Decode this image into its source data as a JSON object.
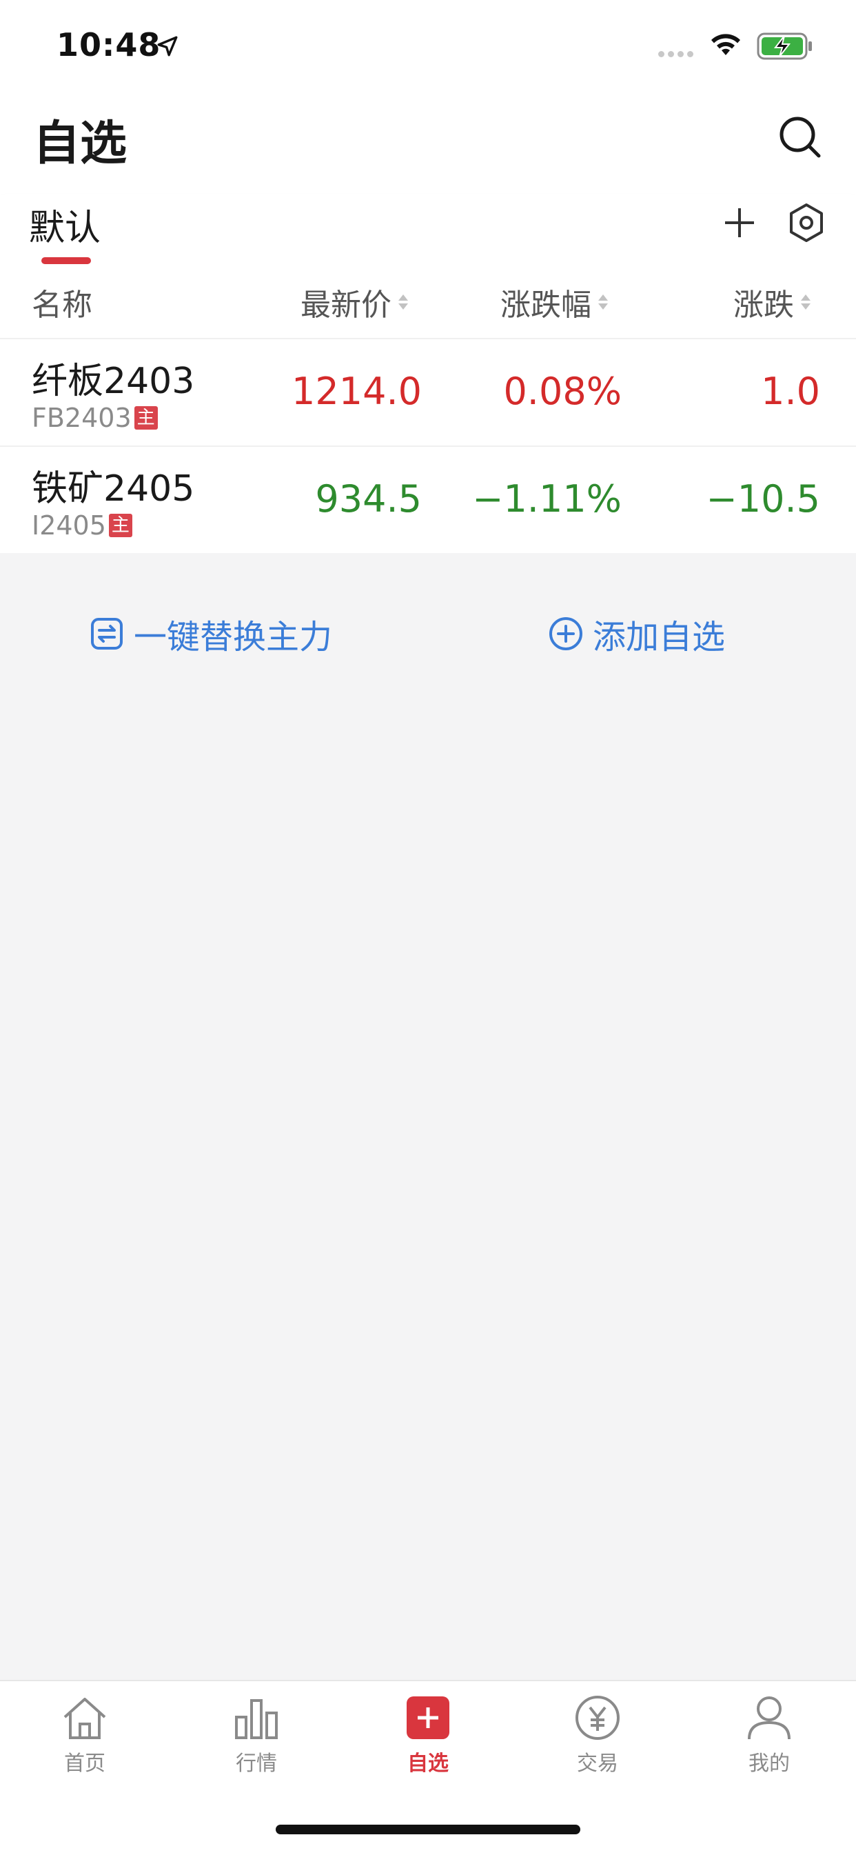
{
  "status_bar": {
    "time": "10:48"
  },
  "header": {
    "title": "自选"
  },
  "tabs": [
    {
      "label": "默认",
      "active": true
    }
  ],
  "columns": {
    "name": "名称",
    "price": "最新价",
    "change_pct": "涨跌幅",
    "change": "涨跌"
  },
  "rows": [
    {
      "name": "纤板2403",
      "code": "FB2403",
      "tag": "主",
      "price": "1214.0",
      "change_pct": "0.08%",
      "change": "1.0",
      "trend": "up"
    },
    {
      "name": "铁矿2405",
      "code": "I2405",
      "tag": "主",
      "price": "934.5",
      "change_pct": "−1.11%",
      "change": "−10.5",
      "trend": "down"
    }
  ],
  "actions": {
    "replace_main": "一键替换主力",
    "add_watch": "添加自选"
  },
  "bottom_nav": [
    {
      "label": "首页",
      "icon": "home-icon"
    },
    {
      "label": "行情",
      "icon": "bar-chart-icon"
    },
    {
      "label": "自选",
      "icon": "plus-square-icon",
      "active": true
    },
    {
      "label": "交易",
      "icon": "yen-icon"
    },
    {
      "label": "我的",
      "icon": "user-icon"
    }
  ],
  "colors": {
    "up": "#d42a2a",
    "down": "#2e8b2e",
    "accent": "#d9363e",
    "link": "#3b7dd8"
  }
}
